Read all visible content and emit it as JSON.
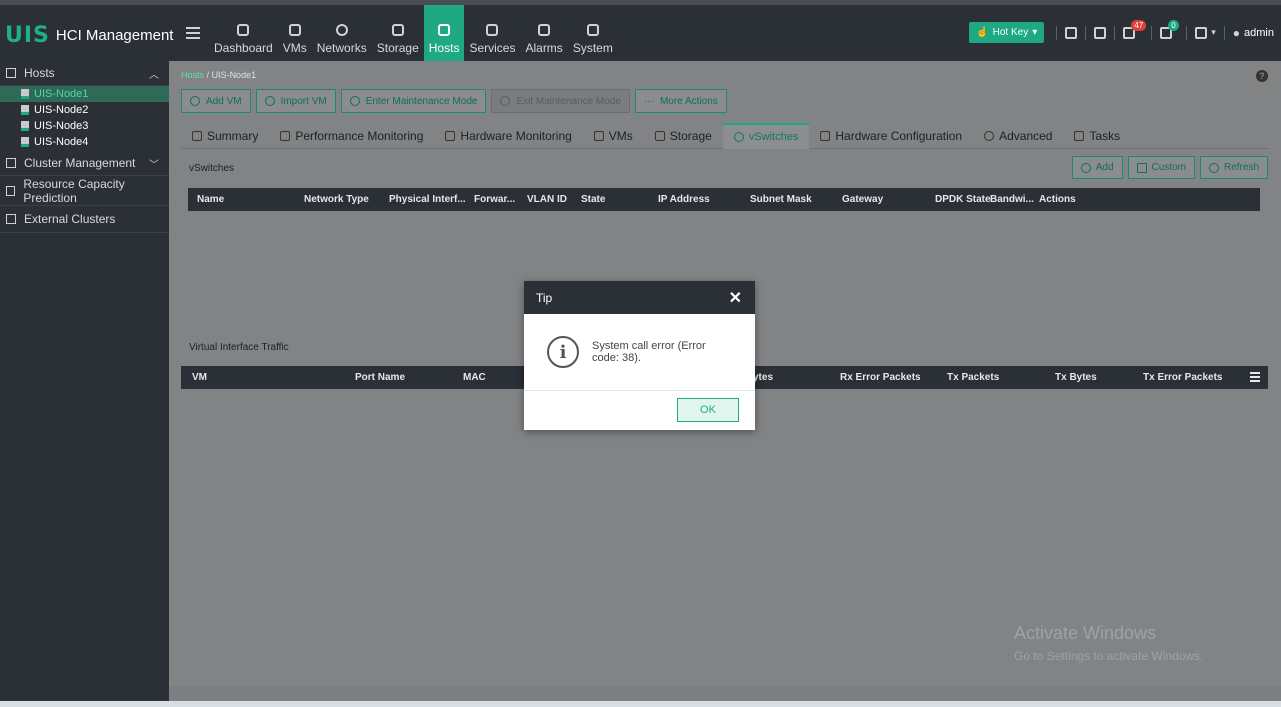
{
  "brand": {
    "logo": "UIS",
    "title": "HCI Management"
  },
  "nav": [
    {
      "label": "Dashboard",
      "icon": "dashboard-icon"
    },
    {
      "label": "VMs",
      "icon": "vm-icon"
    },
    {
      "label": "Networks",
      "icon": "network-icon"
    },
    {
      "label": "Storage",
      "icon": "storage-icon"
    },
    {
      "label": "Hosts",
      "icon": "hosts-icon",
      "active": true
    },
    {
      "label": "Services",
      "icon": "services-icon"
    },
    {
      "label": "Alarms",
      "icon": "alarm-icon"
    },
    {
      "label": "System",
      "icon": "system-icon"
    }
  ],
  "top_right": {
    "hotkey": "Hot Key",
    "alarm_count": "47",
    "task_count": "0",
    "user": "admin"
  },
  "sidebar": {
    "hosts": "Hosts",
    "nodes": [
      "UIS-Node1",
      "UIS-Node2",
      "UIS-Node3",
      "UIS-Node4"
    ],
    "cluster": "Cluster Management",
    "capacity": "Resource Capacity Prediction",
    "external": "External Clusters"
  },
  "breadcrumb": {
    "root": "Hosts",
    "separator": "/",
    "current": "UIS-Node1"
  },
  "toolbar": [
    "Add VM",
    "Import VM",
    "Enter Maintenance Mode",
    "Exit Maintenance Mode",
    "More Actions"
  ],
  "tabs": [
    "Summary",
    "Performance Monitoring",
    "Hardware Monitoring",
    "VMs",
    "Storage",
    "vSwitches",
    "Hardware Configuration",
    "Advanced",
    "Tasks"
  ],
  "vswitches": {
    "title": "vSwitches",
    "actions": [
      "Add",
      "Custom",
      "Refresh"
    ],
    "columns": [
      "Name",
      "Network Type",
      "Physical Interf...",
      "Forwar...",
      "VLAN ID",
      "State",
      "IP Address",
      "Subnet Mask",
      "Gateway",
      "DPDK State",
      "Bandwi...",
      "Actions"
    ]
  },
  "traffic": {
    "title": "Virtual Interface Traffic",
    "columns": [
      "VM",
      "Port Name",
      "MAC",
      "ytes",
      "Rx Error Packets",
      "Tx Packets",
      "Tx Bytes",
      "Tx Error Packets"
    ]
  },
  "watermark": {
    "line1": "Activate Windows",
    "line2": "Go to Settings to activate Windows."
  },
  "modal": {
    "title": "Tip",
    "close": "✕",
    "icon": "i",
    "message": "System call error (Error code: 38).",
    "ok": "OK"
  },
  "colors": {
    "accent": "#1fa982",
    "topbar": "#2b2f36",
    "badge": "#e0403c"
  }
}
